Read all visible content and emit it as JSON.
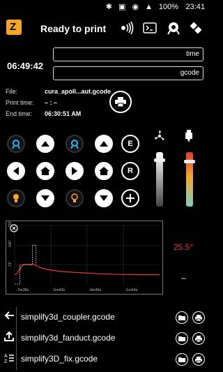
{
  "status": {
    "battery": "100%",
    "time": "23:41",
    "icons": "✱ ▣ ◉ ▲"
  },
  "header": {
    "title": "Ready to print"
  },
  "fields": {
    "time_label": "time",
    "gcode_label": "gcode"
  },
  "clock": "06:49:42",
  "info": {
    "file_label": "File:",
    "file_value": "cura_apoll...aut.gcode",
    "print_time_label": "Print time:",
    "print_time_value": "– : –",
    "end_time_label": "End time:",
    "end_time_value": "06:30:51 AM"
  },
  "controls": {
    "e_label": "E",
    "r_label": "R"
  },
  "fan_level": 0.88,
  "temp_level": 0.85,
  "chart_data": {
    "type": "line",
    "title": "",
    "y_ticks": [
      "220°",
      "146°",
      "73°"
    ],
    "x_ticks": [
      "-7m38s",
      "-5m43s",
      "-3m49s",
      "-1m54s"
    ],
    "series": [
      {
        "color": "#e53935",
        "points": [
          [
            -7.63,
            35
          ],
          [
            -7.5,
            40
          ],
          [
            -7.3,
            62
          ],
          [
            -7.15,
            73
          ],
          [
            -7.0,
            74
          ],
          [
            -6.8,
            72
          ],
          [
            -6.6,
            74
          ],
          [
            -6.5,
            70
          ],
          [
            -6.2,
            60
          ],
          [
            -5.9,
            55
          ],
          [
            -5.5,
            50
          ],
          [
            -5,
            46
          ],
          [
            -4.5,
            44
          ],
          [
            -4,
            42
          ],
          [
            -3.5,
            40
          ],
          [
            -3,
            38
          ],
          [
            -2,
            36
          ],
          [
            -1,
            35
          ],
          [
            0,
            35
          ]
        ]
      },
      {
        "color": "#ffffff",
        "dashed": true,
        "points": [
          [
            -7.63,
            0
          ],
          [
            -7.35,
            0
          ],
          [
            -7.35,
            73
          ],
          [
            -6.7,
            73
          ],
          [
            -6.7,
            146
          ],
          [
            -6.5,
            146
          ],
          [
            -6.5,
            73
          ]
        ]
      }
    ],
    "ylim": [
      0,
      220
    ],
    "xlim": [
      -7.63,
      0
    ]
  },
  "current_temp": "25.5°",
  "target_temp": "–",
  "files": [
    {
      "name": "simplify3d_coupler.gcode"
    },
    {
      "name": "simplify3d_fanduct.gcode"
    },
    {
      "name": "simplify3D_fix.gcode"
    }
  ],
  "colors": {
    "accent": "#f5a623",
    "temp_line": "#e53935",
    "blue_icon": "#29b6f6"
  }
}
